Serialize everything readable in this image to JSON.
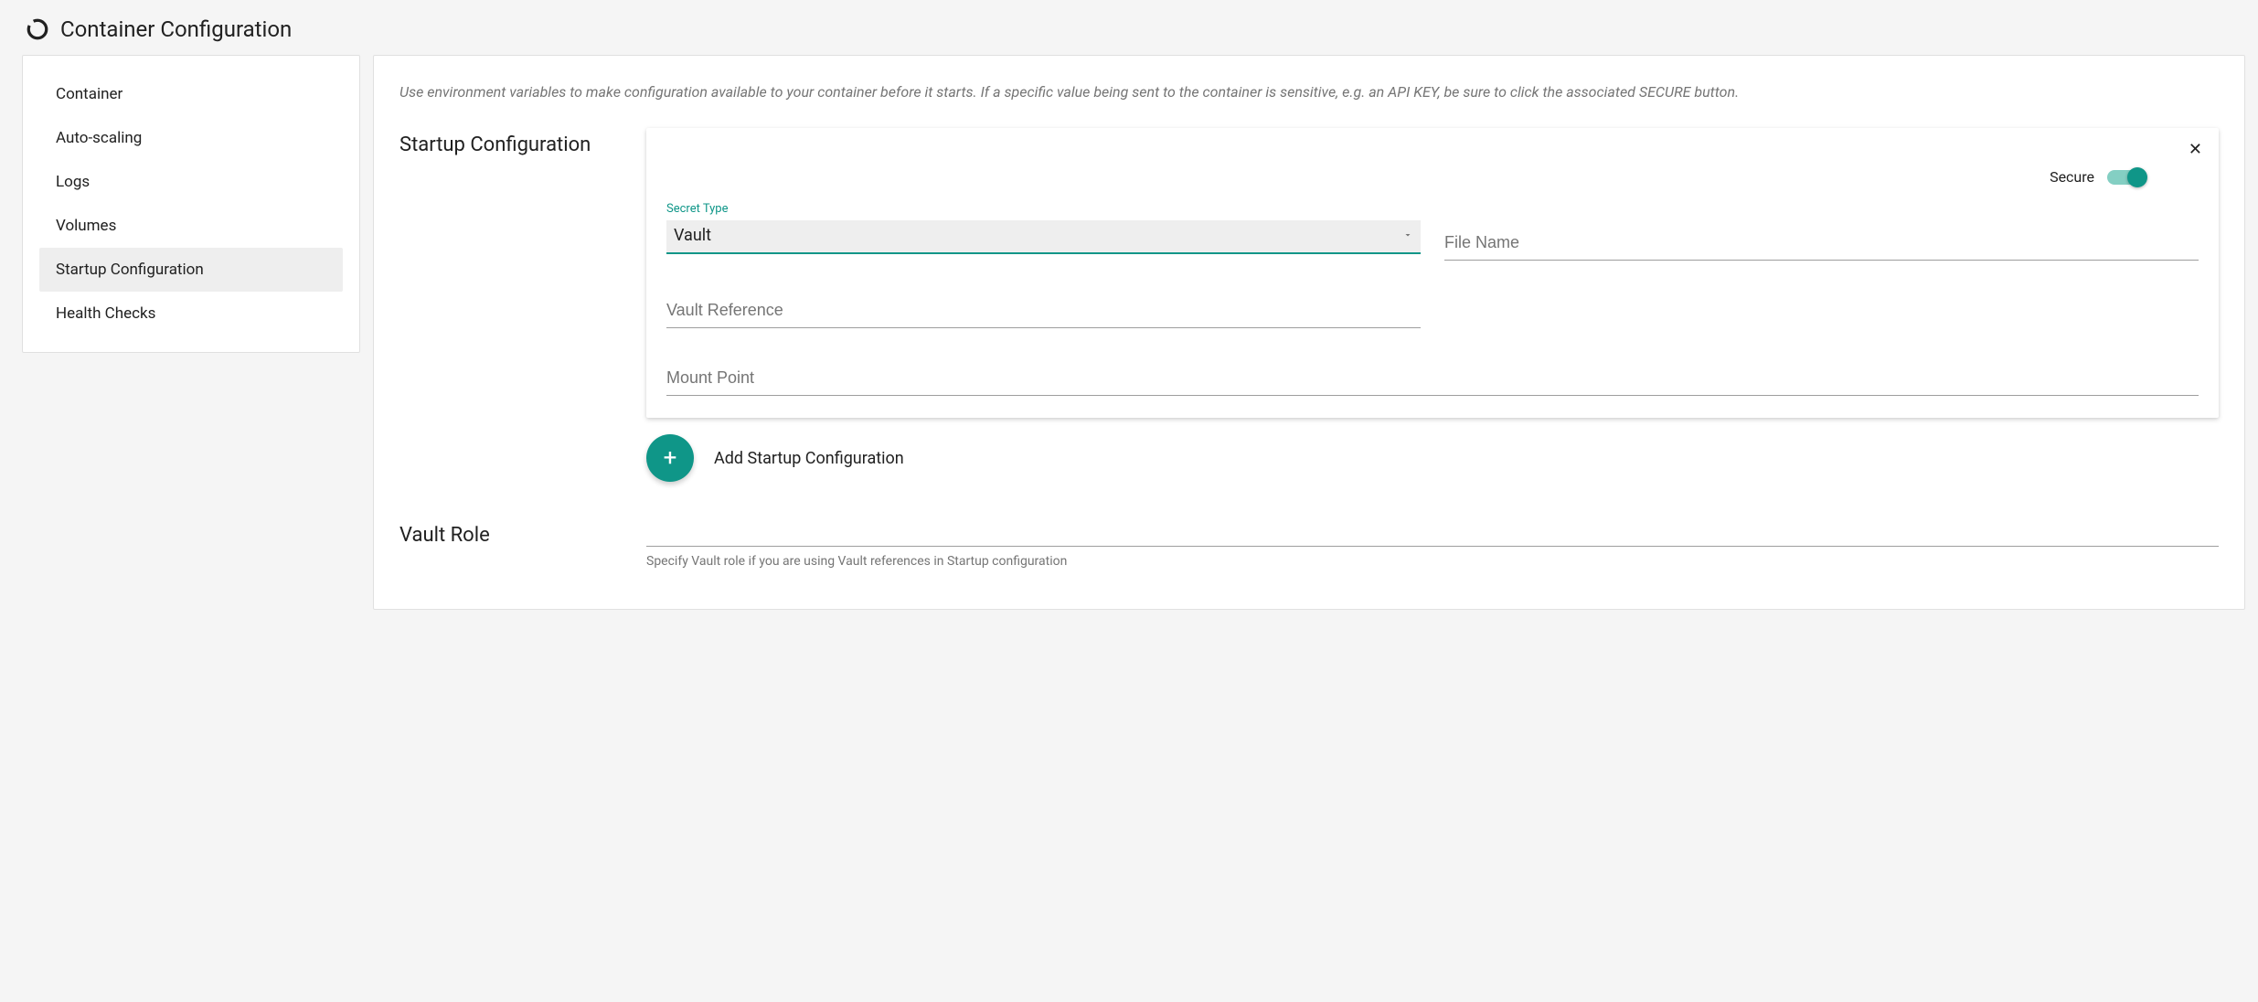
{
  "header": {
    "title": "Container Configuration"
  },
  "sidebar": {
    "items": [
      {
        "label": "Container",
        "active": false
      },
      {
        "label": "Auto-scaling",
        "active": false
      },
      {
        "label": "Logs",
        "active": false
      },
      {
        "label": "Volumes",
        "active": false
      },
      {
        "label": "Startup Configuration",
        "active": true
      },
      {
        "label": "Health Checks",
        "active": false
      }
    ]
  },
  "main": {
    "helpText": "Use environment variables to make configuration available to your container before it starts. If a specific value being sent to the container is sensitive, e.g. an API KEY, be sure to click the associated SECURE button.",
    "startup": {
      "sectionLabel": "Startup Configuration",
      "card": {
        "secureLabel": "Secure",
        "secureOn": true,
        "secretType": {
          "label": "Secret Type",
          "value": "Vault"
        },
        "fields": {
          "fileNamePlaceholder": "File Name",
          "vaultReferencePlaceholder": "Vault Reference",
          "mountPointPlaceholder": "Mount Point"
        }
      },
      "addButton": {
        "label": "Add Startup Configuration",
        "icon": "+"
      }
    },
    "vaultRole": {
      "sectionLabel": "Vault Role",
      "help": "Specify Vault role if you are using Vault references in Startup configuration"
    }
  },
  "colors": {
    "accent": "#0f9688"
  }
}
